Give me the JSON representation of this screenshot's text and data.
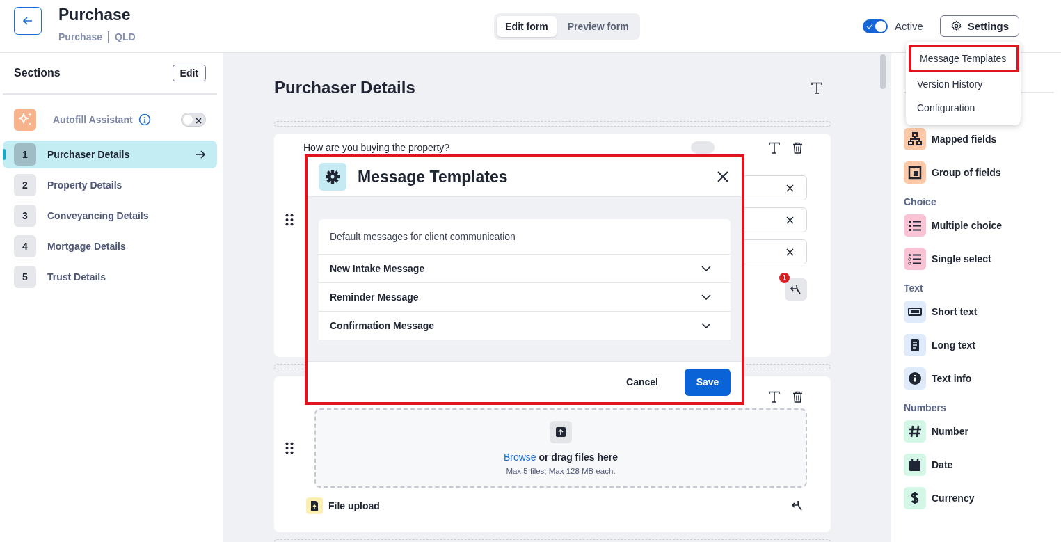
{
  "header": {
    "title": "Purchase",
    "breadcrumb": [
      "Purchase",
      "QLD"
    ]
  },
  "mode_tabs": [
    {
      "label": "Edit form",
      "selected": true
    },
    {
      "label": "Preview form",
      "selected": false
    }
  ],
  "active_toggle": {
    "label": "Active",
    "on": true
  },
  "settings_button": {
    "label": "Settings"
  },
  "settings_menu": [
    {
      "label": "Message Templates",
      "highlighted": true
    },
    {
      "label": "Version History",
      "highlighted": false
    },
    {
      "label": "Configuration",
      "highlighted": false
    }
  ],
  "sections": {
    "title": "Sections",
    "edit_button": "Edit",
    "autofill": {
      "label": "Autofill Assistant",
      "on": false
    },
    "items": [
      {
        "number": "1",
        "label": "Purchaser Details",
        "selected": true
      },
      {
        "number": "2",
        "label": "Property Details",
        "selected": false
      },
      {
        "number": "3",
        "label": "Conveyancing Details",
        "selected": false
      },
      {
        "number": "4",
        "label": "Mortgage Details",
        "selected": false
      },
      {
        "number": "5",
        "label": "Trust Details",
        "selected": false
      }
    ]
  },
  "form": {
    "heading": "Purchaser Details",
    "question": "How are you buying the property?",
    "badge": "1",
    "required_toggles": [
      {
        "on": false
      }
    ],
    "upload": {
      "link": "Browse",
      "text": "or drag files here",
      "hint": "Max 5 files; Max 128 MB each.",
      "type_label": "File upload"
    }
  },
  "modal": {
    "title": "Message Templates",
    "description": "Default messages for client communication",
    "templates": [
      {
        "label": "New Intake Message",
        "expanded": false
      },
      {
        "label": "Reminder Message",
        "expanded": false
      },
      {
        "label": "Confirmation Message",
        "expanded": false
      }
    ],
    "cancel": "Cancel",
    "save": "Save"
  },
  "palette": {
    "groups": [
      {
        "color": "#fbc9a8",
        "items": [
          {
            "label": "Mapped fields",
            "kind": "mapped"
          },
          {
            "label": "Group of fields",
            "kind": "group"
          }
        ]
      },
      {
        "label": "Choice",
        "color": "#f9c3d3",
        "items": [
          {
            "label": "Multiple choice",
            "kind": "multiple"
          },
          {
            "label": "Single select",
            "kind": "single"
          }
        ]
      },
      {
        "label": "Text",
        "color": "#dfeafb",
        "items": [
          {
            "label": "Short text",
            "kind": "short"
          },
          {
            "label": "Long text",
            "kind": "long"
          },
          {
            "label": "Text info",
            "kind": "info"
          }
        ]
      },
      {
        "label": "Numbers",
        "color": "#d3f6e6",
        "items": [
          {
            "label": "Number",
            "kind": "number"
          },
          {
            "label": "Date",
            "kind": "date"
          },
          {
            "label": "Currency",
            "kind": "currency"
          }
        ]
      }
    ]
  }
}
